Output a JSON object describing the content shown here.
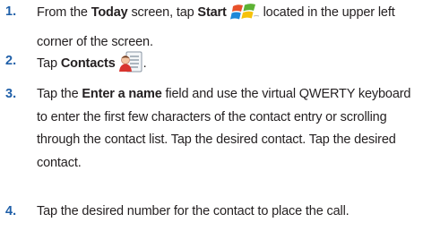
{
  "steps": [
    {
      "number": "1.",
      "pre": "From the ",
      "bold1": "Today",
      "mid": " screen, tap ",
      "bold2": "Start",
      "icon": "windows-start-icon",
      "post": " located in the upper left corner of the screen."
    },
    {
      "number": "2.",
      "pre": "Tap ",
      "bold1": "Contacts",
      "icon": "contacts-card-icon",
      "post": "."
    },
    {
      "number": "3.",
      "pre": "Tap the ",
      "bold1": "Enter a name",
      "post": " field and use the virtual QWERTY keyboard to enter the first few characters of the contact entry or scrolling through the contact list. Tap the desired contact. Tap the desired contact."
    },
    {
      "number": "4.",
      "text": "Tap the desired number for the contact to place the call."
    }
  ]
}
